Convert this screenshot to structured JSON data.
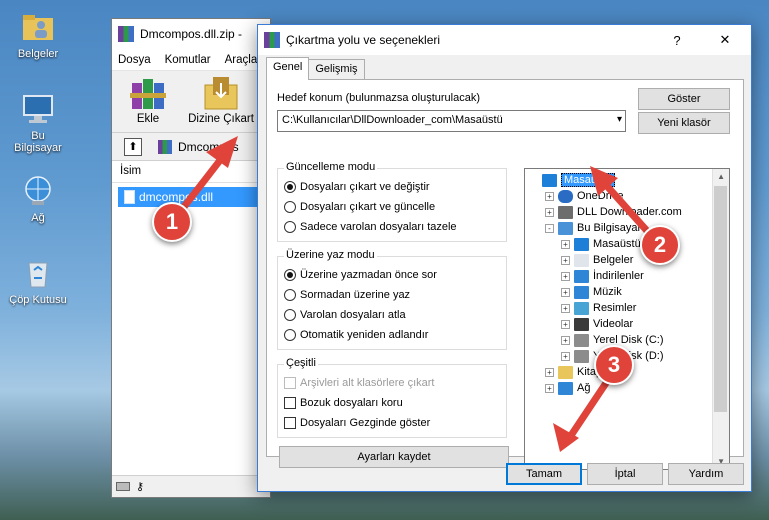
{
  "desktop": {
    "icons": [
      {
        "label": "Belgeler"
      },
      {
        "label": "Bu Bilgisayar"
      },
      {
        "label": "Ağ"
      },
      {
        "label": "Çöp Kutusu"
      }
    ]
  },
  "winrar": {
    "title": "Dmcompos.dll.zip -",
    "menu": [
      "Dosya",
      "Komutlar",
      "Araçla"
    ],
    "tools": [
      "Ekle",
      "Dizine Çıkart"
    ],
    "address": "Dmcompos",
    "column_name": "İsim",
    "file": "dmcompos.dll"
  },
  "dialog": {
    "title": "Çıkartma yolu ve seçenekleri",
    "help_button": "?",
    "close_button": "✕",
    "tabs": [
      "Genel",
      "Gelişmiş"
    ],
    "dest_label": "Hedef konum (bulunmazsa oluşturulacak)",
    "dest_path": "C:\\Kullanıcılar\\DllDownloader_com\\Masaüstü",
    "show_button": "Göster",
    "new_folder_button": "Yeni klasör",
    "update_mode": {
      "title": "Güncelleme modu",
      "options": [
        "Dosyaları çıkart ve değiştir",
        "Dosyaları çıkart ve güncelle",
        "Sadece varolan dosyaları tazele"
      ],
      "selected": 0
    },
    "overwrite_mode": {
      "title": "Üzerine yaz modu",
      "options": [
        "Üzerine yazmadan önce sor",
        "Sormadan üzerine yaz",
        "Varolan dosyaları atla",
        "Otomatik yeniden adlandır"
      ],
      "selected": 0
    },
    "misc": {
      "title": "Çeşitli",
      "options": [
        "Arşivleri alt klasörlere çıkart",
        "Bozuk dosyaları koru",
        "Dosyaları Gezginde göster"
      ]
    },
    "save_settings_button": "Ayarları kaydet",
    "tree": [
      {
        "label": "Masaüstü",
        "level": 0,
        "icon": "desktop-icon",
        "selected": true,
        "exp": ""
      },
      {
        "label": "OneDrive",
        "level": 1,
        "icon": "cloud-icon",
        "exp": "+"
      },
      {
        "label": "DLL Downloader.com",
        "level": 1,
        "icon": "user-icon",
        "exp": "+"
      },
      {
        "label": "Bu Bilgisayar",
        "level": 1,
        "icon": "computer-icon",
        "exp": "-"
      },
      {
        "label": "Masaüstü",
        "level": 2,
        "icon": "desktop-icon",
        "exp": "+"
      },
      {
        "label": "Belgeler",
        "level": 2,
        "icon": "documents-icon",
        "exp": "+"
      },
      {
        "label": "İndirilenler",
        "level": 2,
        "icon": "download-icon",
        "exp": "+"
      },
      {
        "label": "Müzik",
        "level": 2,
        "icon": "music-icon",
        "exp": "+"
      },
      {
        "label": "Resimler",
        "level": 2,
        "icon": "pictures-icon",
        "exp": "+"
      },
      {
        "label": "Videolar",
        "level": 2,
        "icon": "video-icon",
        "exp": "+"
      },
      {
        "label": "Yerel Disk (C:)",
        "level": 2,
        "icon": "drive-icon",
        "exp": "+"
      },
      {
        "label": "Yerel Disk (D:)",
        "level": 2,
        "icon": "drive-icon",
        "exp": "+"
      },
      {
        "label": "Kitaplıklar",
        "level": 1,
        "icon": "library-icon",
        "exp": "+"
      },
      {
        "label": "Ağ",
        "level": 1,
        "icon": "network-icon",
        "exp": "+"
      }
    ],
    "ok_button": "Tamam",
    "cancel_button": "İptal",
    "help_text_button": "Yardım"
  },
  "callouts": [
    "1",
    "2",
    "3"
  ],
  "colors": {
    "arrow": "#e0433a",
    "selection": "#3399ff"
  }
}
